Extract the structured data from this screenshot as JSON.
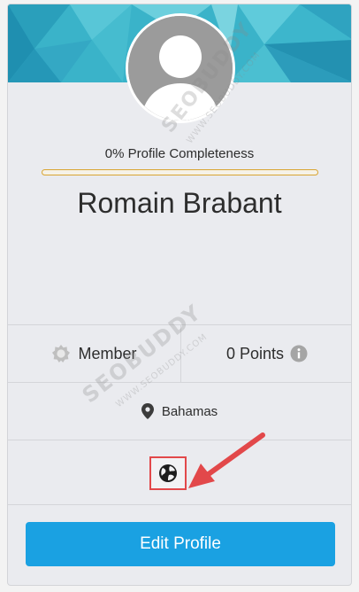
{
  "profile": {
    "completeness_text": "0% Profile Completeness",
    "completeness_value": 0,
    "name": "Romain Brabant"
  },
  "stats": {
    "member_label": "Member",
    "points_label": "0 Points"
  },
  "location": {
    "country": "Bahamas"
  },
  "actions": {
    "edit_profile_label": "Edit Profile"
  },
  "watermark": {
    "brand": "SEOBUDDY",
    "url": "WWW.SEOBUDDY.COM"
  },
  "colors": {
    "banner": "#3ab3c9",
    "progress": "#d9a533",
    "button": "#1aa1e2",
    "highlight": "#e2484a"
  }
}
